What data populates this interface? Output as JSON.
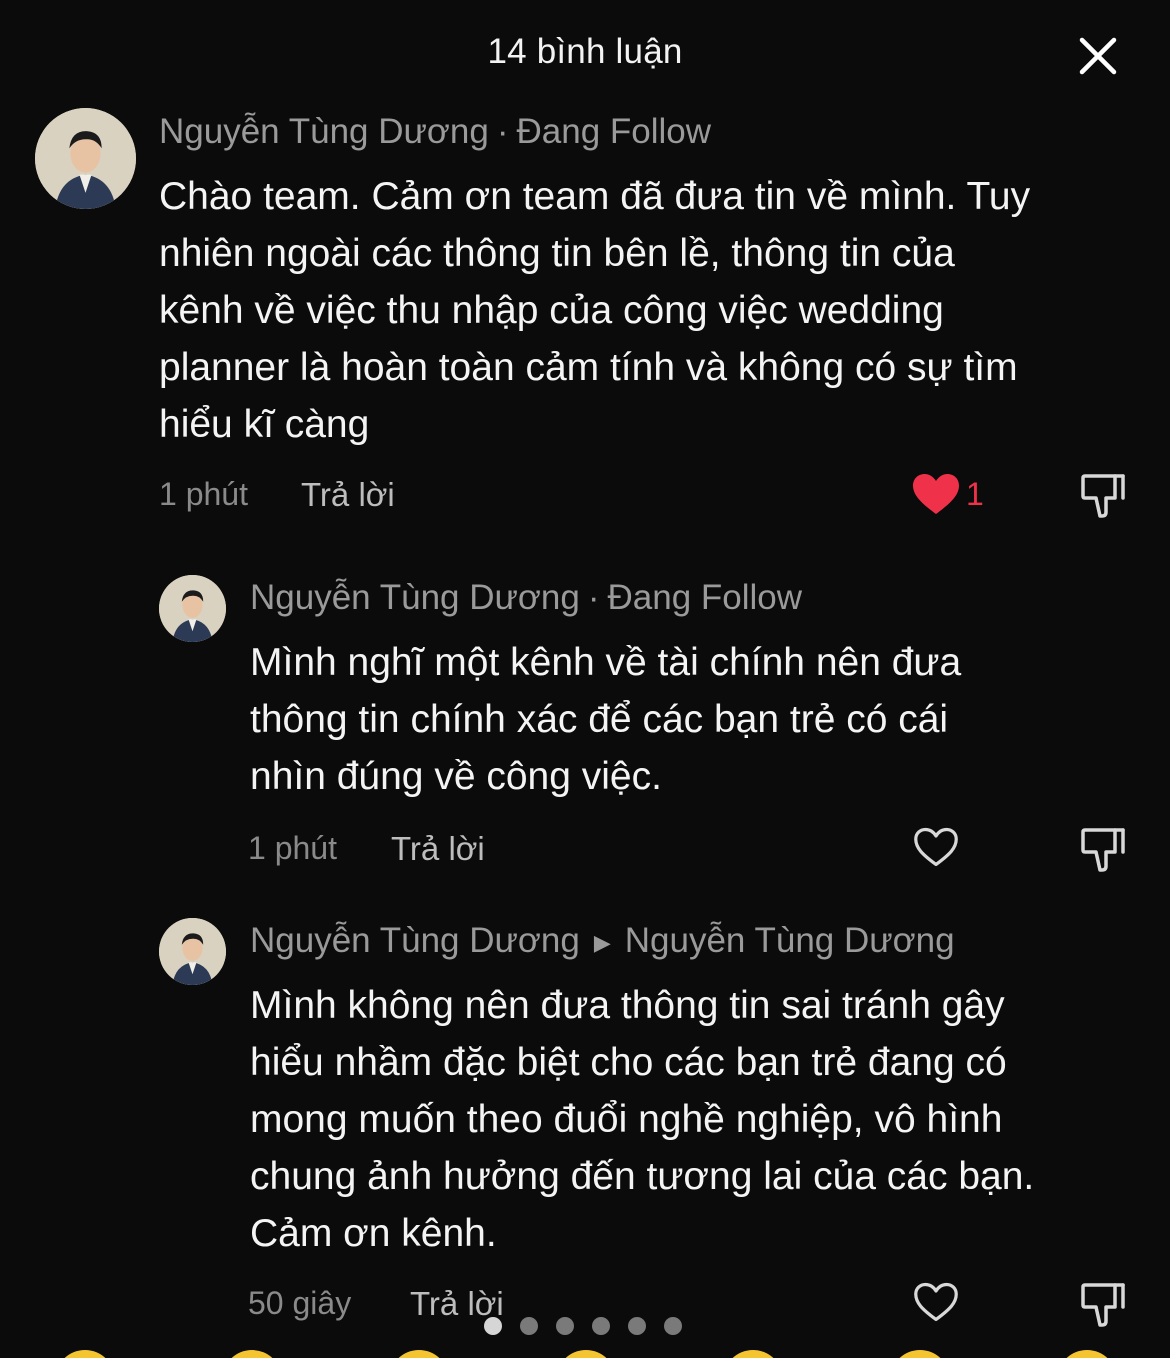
{
  "header": {
    "title": "14 bình luận",
    "close_icon": "close-icon"
  },
  "colors": {
    "background": "#0b0b0c",
    "liked": "#f0314a",
    "muted": "#9a9a9a"
  },
  "comments": [
    {
      "author": "Nguyễn Tùng Dương",
      "separator": "·",
      "follow": "Đang Follow",
      "text_lines": [
        "Chào team. Cảm ơn team đã đưa tin về mình. Tuy",
        "nhiên ngoài các thông tin bên lề, thông tin của",
        "kênh về việc thu nhập của công việc wedding",
        "planner là hoàn toàn cảm tính và không có sự tìm",
        "hiểu kĩ càng"
      ],
      "time": "1 phút",
      "reply": "Trả lời",
      "liked": true,
      "likes": "1"
    },
    {
      "author": "Nguyễn Tùng Dương",
      "separator": "·",
      "follow": "Đang Follow",
      "text_lines": [
        "Mình nghĩ một kênh về tài chính nên đưa",
        "thông tin chính xác để các bạn trẻ có cái",
        "nhìn đúng về công việc."
      ],
      "time": "1 phút",
      "reply": "Trả lời",
      "liked": false
    },
    {
      "author": "Nguyễn Tùng Dương",
      "reply_to": "Nguyễn Tùng Dương",
      "text_lines": [
        "Mình không nên đưa thông tin sai tránh gây",
        "hiểu nhầm đặc biệt cho các bạn trẻ đang có",
        "mong muốn theo đuổi nghề nghiệp, vô hình",
        "chung ảnh hưởng đến tương lai của các bạn.",
        "Cảm ơn kênh."
      ],
      "time": "50 giây",
      "reply": "Trả lời",
      "liked": false
    }
  ],
  "pager": {
    "count": 6,
    "active": 0
  }
}
